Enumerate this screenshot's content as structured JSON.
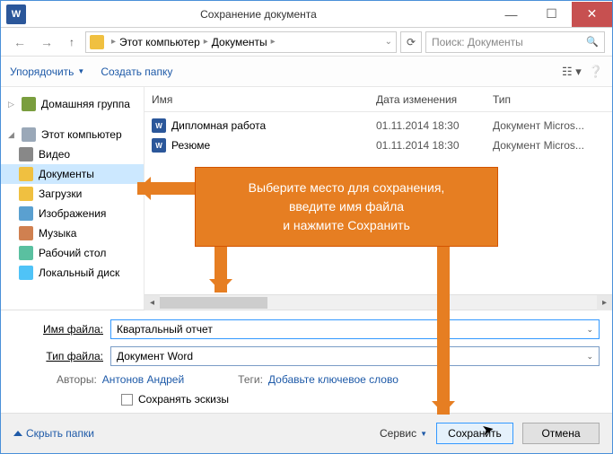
{
  "titlebar": {
    "title": "Сохранение документа"
  },
  "breadcrumb": {
    "seg1": "Этот компьютер",
    "seg2": "Документы"
  },
  "search": {
    "placeholder": "Поиск: Документы"
  },
  "toolbar": {
    "organize": "Упорядочить",
    "newfolder": "Создать папку"
  },
  "sidebar": {
    "homegroup": "Домашняя группа",
    "pc": "Этот компьютер",
    "video": "Видео",
    "documents": "Документы",
    "downloads": "Загрузки",
    "images": "Изображения",
    "music": "Музыка",
    "desktop": "Рабочий стол",
    "localdisk": "Локальный диск"
  },
  "columns": {
    "name": "Имя",
    "date": "Дата изменения",
    "type": "Тип"
  },
  "files": [
    {
      "name": "Дипломная работа",
      "date": "01.11.2014 18:30",
      "type": "Документ Micros..."
    },
    {
      "name": "Резюме",
      "date": "01.11.2014 18:30",
      "type": "Документ Micros..."
    }
  ],
  "form": {
    "filename_label": "Имя файла:",
    "filename_value": "Квартальный отчет",
    "filetype_label": "Тип файла:",
    "filetype_value": "Документ Word",
    "authors_label": "Авторы:",
    "authors_value": "Антонов Андрей",
    "tags_label": "Теги:",
    "tags_value": "Добавьте ключевое слово",
    "thumb_label": "Сохранять эскизы"
  },
  "footer": {
    "hide": "Скрыть папки",
    "tools": "Сервис",
    "save": "Сохранить",
    "cancel": "Отмена"
  },
  "callout": {
    "line1": "Выберите место для сохранения,",
    "line2": "введите имя файла",
    "line3": "и нажмите Сохранить"
  }
}
